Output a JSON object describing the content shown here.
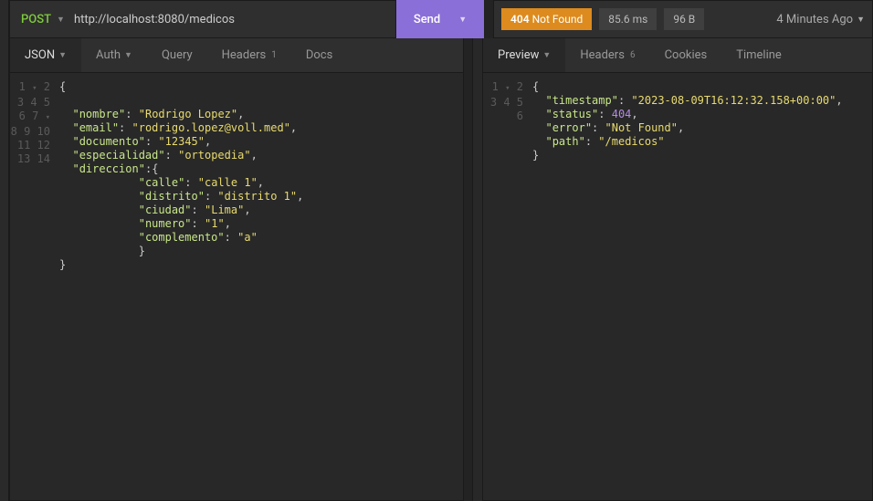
{
  "request": {
    "method": "POST",
    "url": "http://localhost:8080/medicos",
    "sendLabel": "Send"
  },
  "response": {
    "statusCode": "404",
    "statusText": "Not Found",
    "time": "85.6 ms",
    "size": "96 B",
    "ago": "4 Minutes Ago"
  },
  "tabsLeft": {
    "json": "JSON",
    "auth": "Auth",
    "query": "Query",
    "headers": "Headers",
    "headersBadge": "1",
    "docs": "Docs"
  },
  "tabsRight": {
    "preview": "Preview",
    "headers": "Headers",
    "headersBadge": "6",
    "cookies": "Cookies",
    "timeline": "Timeline"
  },
  "requestBody": {
    "keys": {
      "nombre": "nombre",
      "email": "email",
      "documento": "documento",
      "especialidad": "especialidad",
      "direccion": "direccion",
      "calle": "calle",
      "distrito": "distrito",
      "ciudad": "ciudad",
      "numero": "numero",
      "complemento": "complemento"
    },
    "vals": {
      "nombre": "Rodrigo Lopez",
      "email": "rodrigo.lopez@voll.med",
      "documento": "12345",
      "especialidad": "ortopedia",
      "calle": "calle 1",
      "distrito": "distrito 1",
      "ciudad": "Lima",
      "numero": "1",
      "complemento": "a"
    }
  },
  "responseBody": {
    "keys": {
      "timestamp": "timestamp",
      "status": "status",
      "error": "error",
      "path": "path"
    },
    "vals": {
      "timestamp": "2023-08-09T16:12:32.158+00:00",
      "status": 404,
      "error": "Not Found",
      "path": "/medicos"
    }
  }
}
